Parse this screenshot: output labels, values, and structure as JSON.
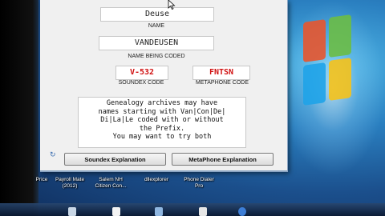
{
  "app": {
    "name_value": "Deuse",
    "name_caption": "NAME",
    "coded_value": "VANDEUSEN",
    "coded_caption": "NAME BEING CODED",
    "soundex_value": "V-532",
    "soundex_caption": "SOUNDEX CODE",
    "metaphone_value": "FNTSN",
    "metaphone_caption": "METAPHONE CODE",
    "explanation": "Genealogy archives may have\nnames starting with Van|Con|De|\nDi|La|Le coded with or without\nthe Prefix.\nYou may want to try both",
    "soundex_button": "Soundex Explanation",
    "metaphone_button": "MetaPhone Explanation"
  },
  "desktop": {
    "icons": [
      {
        "label": "Price"
      },
      {
        "label": "Payroll Mate\n(2012)"
      },
      {
        "label": "Salem NH\nCitizen Con..."
      },
      {
        "label": "dllexplorer"
      },
      {
        "label": "Phone Dialer\nPro"
      }
    ]
  },
  "colors": {
    "code_text": "#d01010",
    "desktop_blue": "#2a7fc0"
  }
}
